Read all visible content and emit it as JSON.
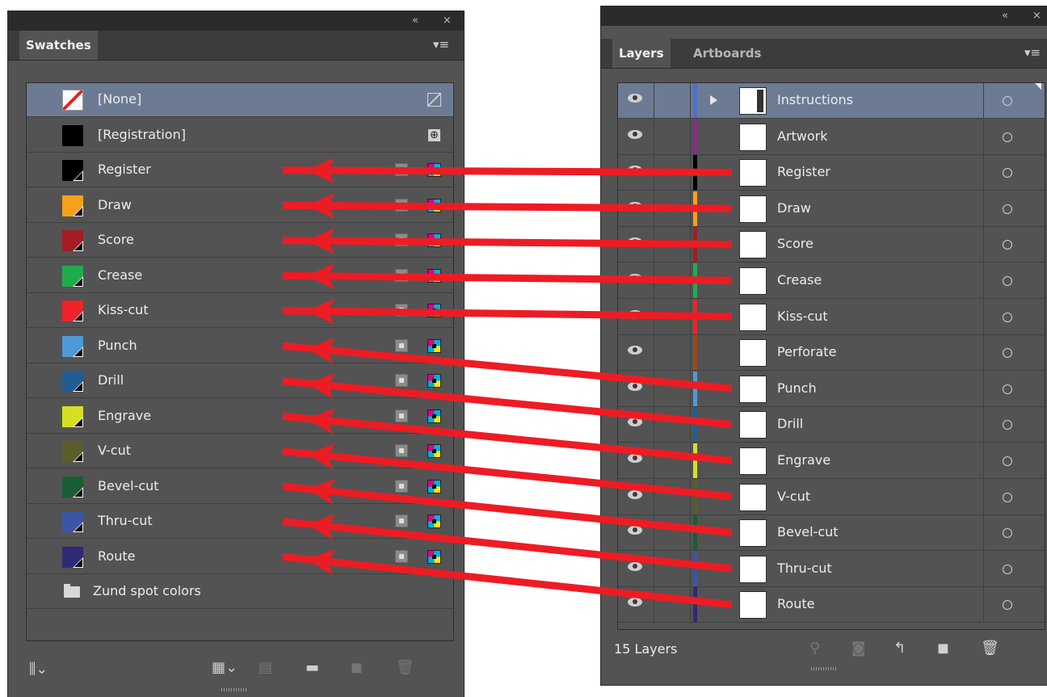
{
  "swatches_panel": {
    "tab_label": "Swatches",
    "collapse_glyph": "«",
    "close_glyph": "×",
    "menu_glyph": "▾≡",
    "items": [
      {
        "name": "[None]",
        "color": "none",
        "kind": "none",
        "selected": true
      },
      {
        "name": "[Registration]",
        "color": "#000000",
        "kind": "registration"
      },
      {
        "name": "Register",
        "color": "#000000",
        "kind": "spot"
      },
      {
        "name": "Draw",
        "color": "#f7a21b",
        "kind": "spot"
      },
      {
        "name": "Score",
        "color": "#a31e22",
        "kind": "spot"
      },
      {
        "name": "Crease",
        "color": "#1fad4b",
        "kind": "spot"
      },
      {
        "name": "Kiss-cut",
        "color": "#ee2329",
        "kind": "spot"
      },
      {
        "name": "Punch",
        "color": "#4e9ad6",
        "kind": "spot"
      },
      {
        "name": "Drill",
        "color": "#215d93",
        "kind": "spot"
      },
      {
        "name": "Engrave",
        "color": "#d7df23",
        "kind": "spot"
      },
      {
        "name": "V-cut",
        "color": "#5b5d2b",
        "kind": "spot"
      },
      {
        "name": "Bevel-cut",
        "color": "#1a5e34",
        "kind": "spot"
      },
      {
        "name": "Thru-cut",
        "color": "#3c56a6",
        "kind": "spot"
      },
      {
        "name": "Route",
        "color": "#2e2a78",
        "kind": "spot"
      },
      {
        "name": "Zund spot colors",
        "kind": "folder"
      }
    ],
    "bottom_icons": [
      "swatch-libraries-icon",
      "show-swatch-kinds-icon",
      "swatch-options-icon",
      "new-color-group-icon",
      "new-swatch-icon",
      "delete-swatch-icon"
    ]
  },
  "layers_panel": {
    "tabs": [
      {
        "label": "Layers",
        "active": true
      },
      {
        "label": "Artboards",
        "active": false
      }
    ],
    "collapse_glyph": "«",
    "close_glyph": "×",
    "menu_glyph": "▾≡",
    "layers": [
      {
        "name": "Instructions",
        "color": "#4f6fc8",
        "selected": true,
        "expandable": true
      },
      {
        "name": "Artwork",
        "color": "#8a2a8a"
      },
      {
        "name": "Register",
        "color": "#000000"
      },
      {
        "name": "Draw",
        "color": "#f7a21b"
      },
      {
        "name": "Score",
        "color": "#a31e22"
      },
      {
        "name": "Crease",
        "color": "#1fad4b"
      },
      {
        "name": "Kiss-cut",
        "color": "#ee2329"
      },
      {
        "name": "Perforate",
        "color": "#9c4a1a"
      },
      {
        "name": "Punch",
        "color": "#4e9ad6"
      },
      {
        "name": "Drill",
        "color": "#215d93"
      },
      {
        "name": "Engrave",
        "color": "#d7df23"
      },
      {
        "name": "V-cut",
        "color": "#5b5d2b"
      },
      {
        "name": "Bevel-cut",
        "color": "#1a5e34"
      },
      {
        "name": "Thru-cut",
        "color": "#3c56a6"
      },
      {
        "name": "Route",
        "color": "#2e2a78"
      }
    ],
    "layer_count": "15 Layers",
    "bottom_icons": [
      "locate-object-icon",
      "make-clipping-mask-icon",
      "create-sublayer-icon",
      "new-layer-icon",
      "delete-layer-icon"
    ]
  },
  "annotation": {
    "arrow_color": "#ed1c24",
    "mappings": [
      {
        "from_layer": "Register",
        "to_swatch": "Register"
      },
      {
        "from_layer": "Draw",
        "to_swatch": "Draw"
      },
      {
        "from_layer": "Score",
        "to_swatch": "Score"
      },
      {
        "from_layer": "Crease",
        "to_swatch": "Crease"
      },
      {
        "from_layer": "Kiss-cut",
        "to_swatch": "Kiss-cut"
      },
      {
        "from_layer": "Punch",
        "to_swatch": "Punch"
      },
      {
        "from_layer": "Drill",
        "to_swatch": "Drill"
      },
      {
        "from_layer": "Engrave",
        "to_swatch": "Engrave"
      },
      {
        "from_layer": "V-cut",
        "to_swatch": "V-cut"
      },
      {
        "from_layer": "Bevel-cut",
        "to_swatch": "Bevel-cut"
      },
      {
        "from_layer": "Thru-cut",
        "to_swatch": "Thru-cut"
      },
      {
        "from_layer": "Route",
        "to_swatch": "Route"
      }
    ]
  }
}
